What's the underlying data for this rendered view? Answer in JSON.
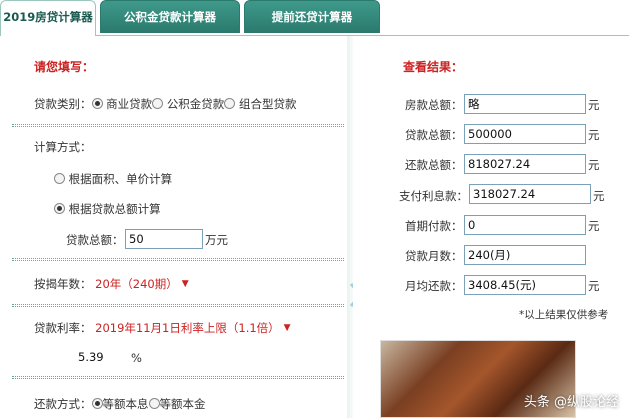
{
  "tabs": [
    {
      "label": "2019房贷计算器"
    },
    {
      "label": "公积金贷款计算器"
    },
    {
      "label": "提前还贷计算器"
    }
  ],
  "form": {
    "title": "请您填写：",
    "loan_type_label": "贷款类别：",
    "loan_types": [
      "商业贷款",
      "公积金贷款",
      "组合型贷款"
    ],
    "calc_method_label": "计算方式：",
    "calc_methods": [
      "根据面积、单价计算",
      "根据贷款总额计算"
    ],
    "loan_total_label": "贷款总额：",
    "loan_total_value": "50",
    "loan_total_unit": "万元",
    "years_label": "按揭年数：",
    "years_value": "20年（240期）",
    "rate_label": "贷款利率：",
    "rate_value": "2019年11月1日利率上限（1.1倍）",
    "rate_number": "5.39",
    "rate_unit": "%",
    "repay_label": "还款方式：",
    "repay_methods": [
      "等额本息",
      "等额本金"
    ]
  },
  "result": {
    "title": "查看结果：",
    "rows": [
      {
        "label": "房款总额：",
        "value": "略",
        "unit": "元"
      },
      {
        "label": "贷款总额：",
        "value": "500000",
        "unit": "元"
      },
      {
        "label": "还款总额：",
        "value": "818027.24",
        "unit": "元"
      },
      {
        "label": "支付利息款：",
        "value": "318027.24",
        "unit": "元"
      },
      {
        "label": "首期付款：",
        "value": "0",
        "unit": "元"
      },
      {
        "label": "贷款月数：",
        "value": "240(月)",
        "unit": ""
      },
      {
        "label": "月均还款：",
        "value": "3408.45(元)",
        "unit": "元"
      }
    ],
    "note": "*以上结果仅供参考"
  },
  "watermark": "头条 @纵股论经",
  "icons": {
    "dropdown": "triangle-down-icon",
    "next": "double-chevron-right-icon"
  },
  "colors": {
    "accent_red": "#cc2222",
    "tab_green": "#2a7a6d"
  }
}
